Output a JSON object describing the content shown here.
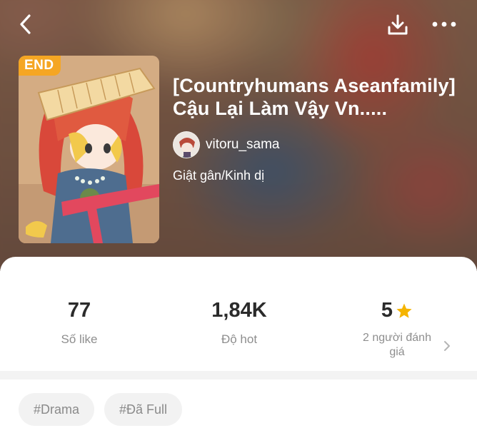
{
  "header": {
    "back_icon": "chevron-left-icon",
    "download_icon": "download-icon",
    "more_icon": "more-horizontal-icon"
  },
  "book": {
    "badge": "END",
    "title_line1": "[Countryhumans Aseanfamily]",
    "title_line2": "Cậu Lại Làm Vậy Vn.....",
    "author": "vitoru_sama",
    "genre": "Giật gân/Kinh dị"
  },
  "stats": {
    "likes": {
      "value": "77",
      "label": "Số like"
    },
    "hot": {
      "value": "1,84K",
      "label": "Độ hot"
    },
    "rating": {
      "value": "5",
      "label_line1": "2 người đánh",
      "label_line2": "giá",
      "star_color": "#f5b400"
    }
  },
  "tags": [
    "#Drama",
    "#Đã Full"
  ],
  "colors": {
    "badge": "#f5a623",
    "star": "#f5b400"
  }
}
